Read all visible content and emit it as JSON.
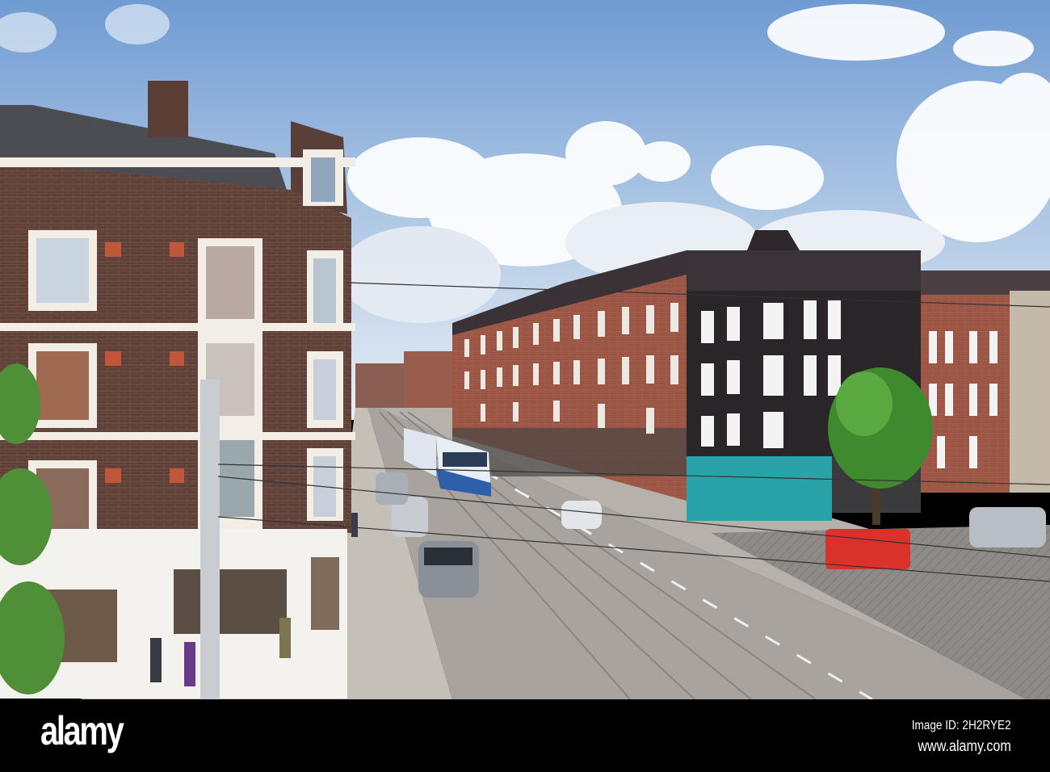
{
  "watermark": {
    "logo": "alamy",
    "image_id": "Image ID: 2H2RYE2",
    "website": "www.alamy.com"
  },
  "colors": {
    "sky": "#7fa6d6",
    "brick_left": "#5e4038",
    "brick_right": "#9a5444",
    "dark_building": "#2a2528",
    "teal_shopfront": "#2aa3a8",
    "road": "#a8a39e",
    "tram": "#2e5fa8"
  }
}
